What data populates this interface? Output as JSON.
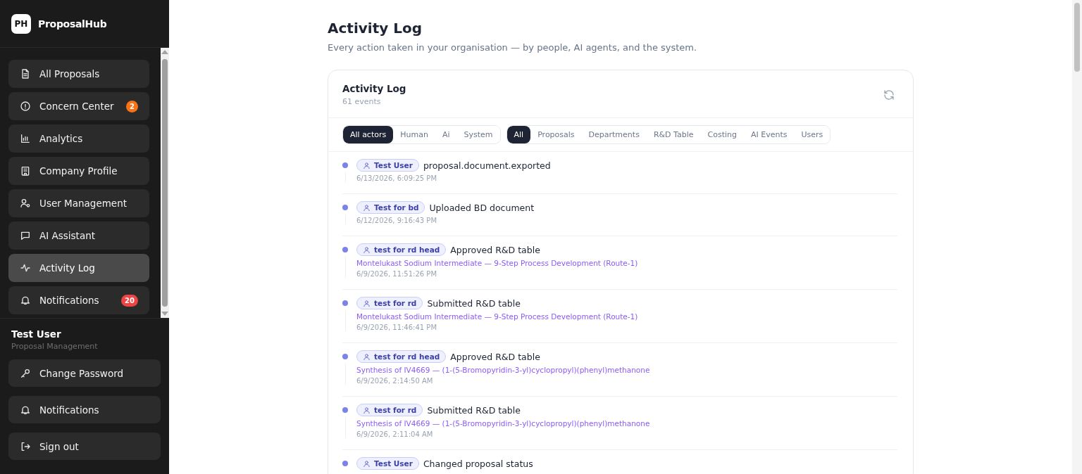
{
  "brand": {
    "logo": "PH",
    "name": "ProposalHub"
  },
  "nav": [
    {
      "label": "All Proposals",
      "kind": "document",
      "selected": false
    },
    {
      "label": "Concern Center",
      "kind": "alert",
      "selected": false,
      "badge": "2",
      "color": "#f97316"
    },
    {
      "label": "Analytics",
      "kind": "chart",
      "selected": false
    },
    {
      "label": "Company Profile",
      "kind": "building",
      "selected": false
    },
    {
      "label": "User Management",
      "kind": "user-gear",
      "selected": false
    },
    {
      "label": "AI Assistant",
      "kind": "chat",
      "selected": false
    },
    {
      "label": "Activity Log",
      "kind": "pulse",
      "selected": true
    },
    {
      "label": "Notifications",
      "kind": "bell",
      "selected": false,
      "badge": "20",
      "color": "#ef4444"
    }
  ],
  "user": {
    "name": "Test User",
    "role": "Proposal Management"
  },
  "footer_actions": [
    {
      "label": "Change Password",
      "kind": "key"
    },
    {
      "label": "Notifications",
      "kind": "bell"
    },
    {
      "label": "Sign out",
      "kind": "signout"
    }
  ],
  "page": {
    "title": "Activity Log",
    "subtitle": "Every action taken in your organisation — by people, AI agents, and the system."
  },
  "card": {
    "title": "Activity Log",
    "count": "61 events",
    "actor_filters": [
      {
        "label": "All actors",
        "selected": true
      },
      {
        "label": "Human",
        "selected": false
      },
      {
        "label": "Ai",
        "selected": false
      },
      {
        "label": "System",
        "selected": false
      }
    ],
    "category_filters": [
      {
        "label": "All",
        "selected": true
      },
      {
        "label": "Proposals",
        "selected": false
      },
      {
        "label": "Departments",
        "selected": false
      },
      {
        "label": "R&D Table",
        "selected": false
      },
      {
        "label": "Costing",
        "selected": false
      },
      {
        "label": "AI Events",
        "selected": false
      },
      {
        "label": "Users",
        "selected": false
      }
    ],
    "events": [
      {
        "actor": "Test User",
        "action": "proposal.document.exported",
        "time": "6/13/2026, 6:09:25 PM"
      },
      {
        "actor": "Test for bd",
        "action": "Uploaded BD document",
        "time": "6/12/2026, 9:16:43 PM"
      },
      {
        "actor": "test for rd head",
        "action": "Approved R&D table",
        "link": "Montelukast Sodium Intermediate — 9-Step Process Development (Route-1)",
        "time": "6/9/2026, 11:51:26 PM"
      },
      {
        "actor": "test for rd",
        "action": "Submitted R&D table",
        "link": "Montelukast Sodium Intermediate — 9-Step Process Development (Route-1)",
        "time": "6/9/2026, 11:46:41 PM"
      },
      {
        "actor": "test for rd head",
        "action": "Approved R&D table",
        "link": "Synthesis of IV4669 — (1-(5-Bromopyridin-3-yl)cyclopropyl)(phenyl)methanone",
        "time": "6/9/2026, 2:14:50 AM"
      },
      {
        "actor": "test for rd",
        "action": "Submitted R&D table",
        "link": "Synthesis of IV4669 — (1-(5-Bromopyridin-3-yl)cyclopropyl)(phenyl)methanone",
        "time": "6/9/2026, 2:11:04 AM"
      },
      {
        "actor": "Test User",
        "action": "Changed proposal status"
      }
    ]
  }
}
